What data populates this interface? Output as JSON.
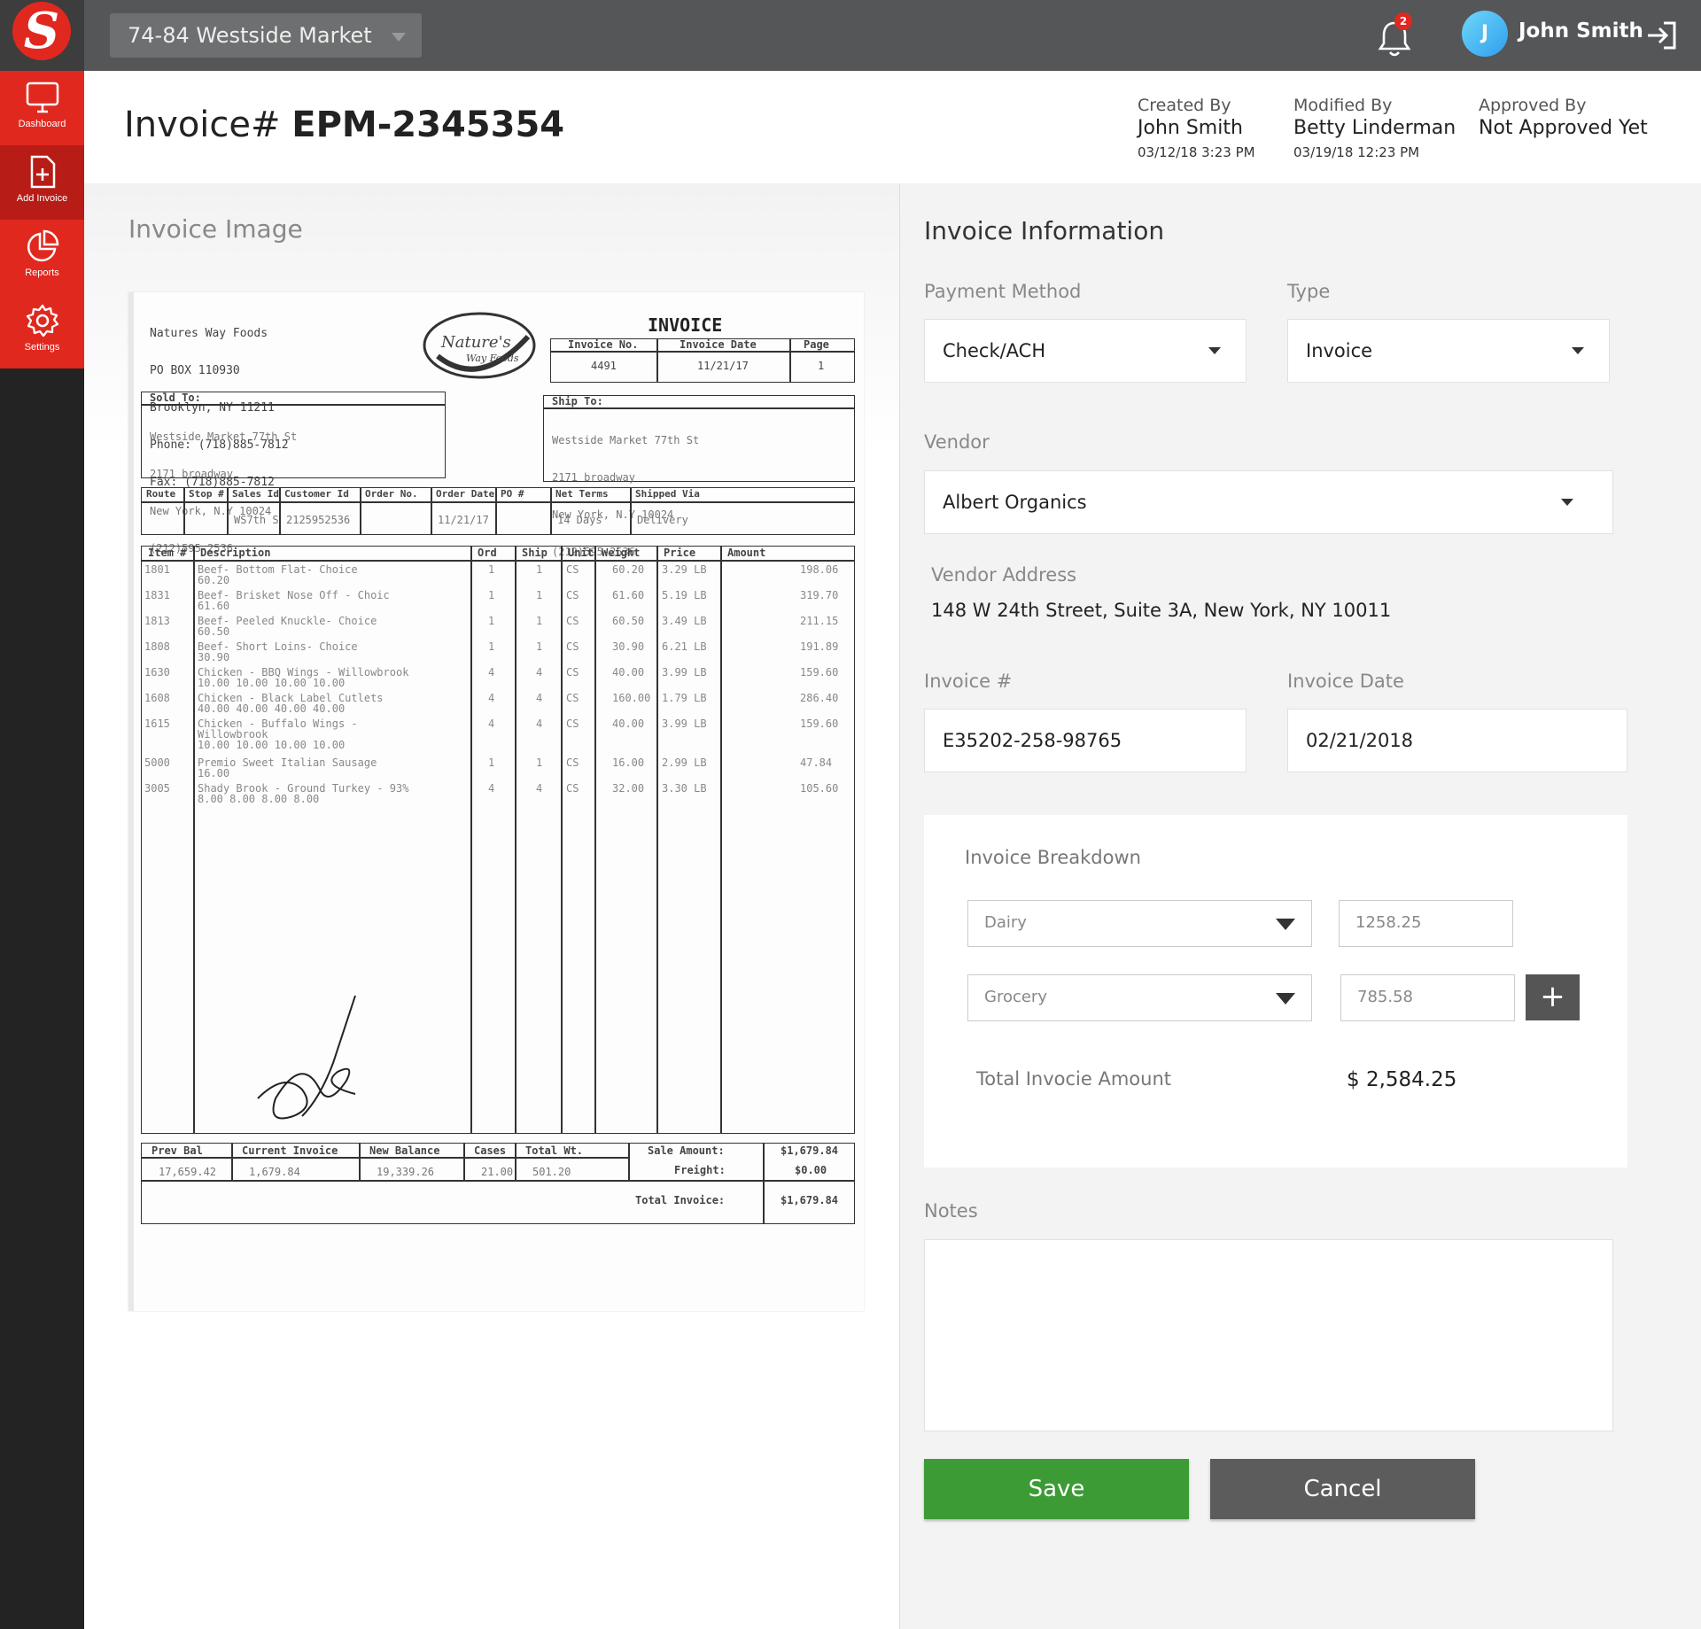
{
  "topbar": {
    "store": "74-84 Westside Market",
    "notifications_count": "2",
    "user_initial": "J",
    "user_name": "John Smith"
  },
  "sidebar": {
    "items": [
      {
        "label": "Dashboard",
        "icon": "monitor-icon"
      },
      {
        "label": "Add Invoice",
        "icon": "file-plus-icon"
      },
      {
        "label": "Reports",
        "icon": "pie-chart-icon"
      },
      {
        "label": "Settings",
        "icon": "gear-icon"
      }
    ]
  },
  "header": {
    "title_prefix": "Invoice# ",
    "invoice_number": "EPM-2345354",
    "created": {
      "label": "Created By",
      "name": "John Smith",
      "date": "03/12/18 3:23 PM"
    },
    "modified": {
      "label": "Modified By",
      "name": "Betty Linderman",
      "date": "03/19/18 12:23 PM"
    },
    "approved": {
      "label": "Approved By",
      "name": "Not Approved Yet"
    }
  },
  "left": {
    "title": "Invoice Image"
  },
  "document": {
    "vendor_block": [
      "Natures Way Foods",
      "PO BOX 110930",
      "Brooklyn, NY 11211",
      "Phone: (718)885-7812",
      "Fax: (718)885-7812"
    ],
    "heading": "INVOICE",
    "inv_headers": [
      "Invoice No.",
      "Invoice Date",
      "Page"
    ],
    "inv_values": [
      "4491",
      "11/21/17",
      "1"
    ],
    "sold_to_label": "Sold To:",
    "sold_to": [
      "Westside Market 77th St",
      "2171 broadway",
      "New York, N.Y 10024",
      "(212)595-2536"
    ],
    "ship_to_label": "Ship To:",
    "ship_to": [
      "Westside Market 77th St",
      "2171 broadway",
      "New York, N.Y 10024",
      "(212)595-2536"
    ],
    "order_headers": [
      "Route",
      "Stop #",
      "Sales Id",
      "Customer Id",
      "Order No.",
      "Order Date",
      "PO #",
      "Net Terms",
      "Shipped Via"
    ],
    "order_values": [
      "",
      "",
      "WS7th S",
      "2125952536",
      "",
      "11/21/17",
      "",
      "14 Days",
      "Delivery"
    ],
    "line_headers": [
      "Item #",
      "Description",
      "Ord",
      "Ship",
      "Unit",
      "Weight",
      "Price",
      "Amount"
    ],
    "lines": [
      {
        "item": "1801",
        "desc": "Beef- Bottom Flat- Choice",
        "sub": "60.20",
        "ord": "1",
        "ship": "1",
        "unit": "CS",
        "weight": "60.20",
        "price": "3.29 LB",
        "amount": "198.06"
      },
      {
        "item": "1831",
        "desc": "Beef- Brisket Nose Off - Choic",
        "sub": "61.60",
        "ord": "1",
        "ship": "1",
        "unit": "CS",
        "weight": "61.60",
        "price": "5.19 LB",
        "amount": "319.70"
      },
      {
        "item": "1813",
        "desc": "Beef- Peeled Knuckle- Choice",
        "sub": "60.50",
        "ord": "1",
        "ship": "1",
        "unit": "CS",
        "weight": "60.50",
        "price": "3.49 LB",
        "amount": "211.15"
      },
      {
        "item": "1808",
        "desc": "Beef- Short Loins- Choice",
        "sub": "30.90",
        "ord": "1",
        "ship": "1",
        "unit": "CS",
        "weight": "30.90",
        "price": "6.21 LB",
        "amount": "191.89"
      },
      {
        "item": "1630",
        "desc": "Chicken - BBQ Wings - Willowbrook",
        "sub": "10.00 10.00 10.00 10.00",
        "ord": "4",
        "ship": "4",
        "unit": "CS",
        "weight": "40.00",
        "price": "3.99 LB",
        "amount": "159.60"
      },
      {
        "item": "1608",
        "desc": "Chicken - Black Label Cutlets",
        "sub": "40.00 40.00 40.00 40.00",
        "ord": "4",
        "ship": "4",
        "unit": "CS",
        "weight": "160.00",
        "price": "1.79 LB",
        "amount": "286.40"
      },
      {
        "item": "1615",
        "desc": "Chicken - Buffalo Wings -",
        "sub": "Willowbrook",
        "sub2": "10.00 10.00 10.00 10.00",
        "ord": "4",
        "ship": "4",
        "unit": "CS",
        "weight": "40.00",
        "price": "3.99 LB",
        "amount": "159.60"
      },
      {
        "item": "5000",
        "desc": "Premio Sweet Italian Sausage",
        "sub": "16.00",
        "ord": "1",
        "ship": "1",
        "unit": "CS",
        "weight": "16.00",
        "price": "2.99 LB",
        "amount": "47.84"
      },
      {
        "item": "3005",
        "desc": "Shady Brook - Ground Turkey - 93%",
        "sub": "8.00 8.00 8.00 8.00",
        "ord": "4",
        "ship": "4",
        "unit": "CS",
        "weight": "32.00",
        "price": "3.30 LB",
        "amount": "105.60"
      }
    ],
    "totals_headers": [
      "Prev Bal",
      "Current Invoice",
      "New Balance",
      "Cases",
      "Total Wt."
    ],
    "totals_values": [
      "17,659.42",
      "1,679.84",
      "19,339.26",
      "21.00",
      "501.20"
    ],
    "sale_amount_label": "Sale Amount:",
    "sale_amount": "$1,679.84",
    "freight_label": "Freight:",
    "freight": "$0.00",
    "total_invoice_label": "Total Invoice:",
    "total_invoice": "$1,679.84"
  },
  "form": {
    "title": "Invoice Information",
    "payment_method": {
      "label": "Payment Method",
      "value": "Check/ACH"
    },
    "type": {
      "label": "Type",
      "value": "Invoice"
    },
    "vendor": {
      "label": "Vendor",
      "value": "Albert Organics"
    },
    "vendor_address": {
      "label": "Vendor Address",
      "value": "148 W 24th Street, Suite 3A, New York, NY 10011"
    },
    "invoice_no": {
      "label": "Invoice #",
      "value": "E35202-258-98765"
    },
    "invoice_date": {
      "label": "Invoice Date",
      "value": "02/21/2018"
    },
    "breakdown": {
      "title": "Invoice Breakdown",
      "rows": [
        {
          "category": "Dairy",
          "amount": "1258.25"
        },
        {
          "category": "Grocery",
          "amount": "785.58"
        }
      ],
      "add_label": "+",
      "total_label": "Total Invocie Amount",
      "total_value": "$ 2,584.25"
    },
    "notes_label": "Notes",
    "notes_value": "",
    "save_label": "Save",
    "cancel_label": "Cancel"
  },
  "colors": {
    "brand_red": "#e0281f",
    "save_green": "#3d9b35",
    "cancel_gray": "#5c5c5c",
    "topbar": "#555657",
    "sidebar": "#232323"
  }
}
